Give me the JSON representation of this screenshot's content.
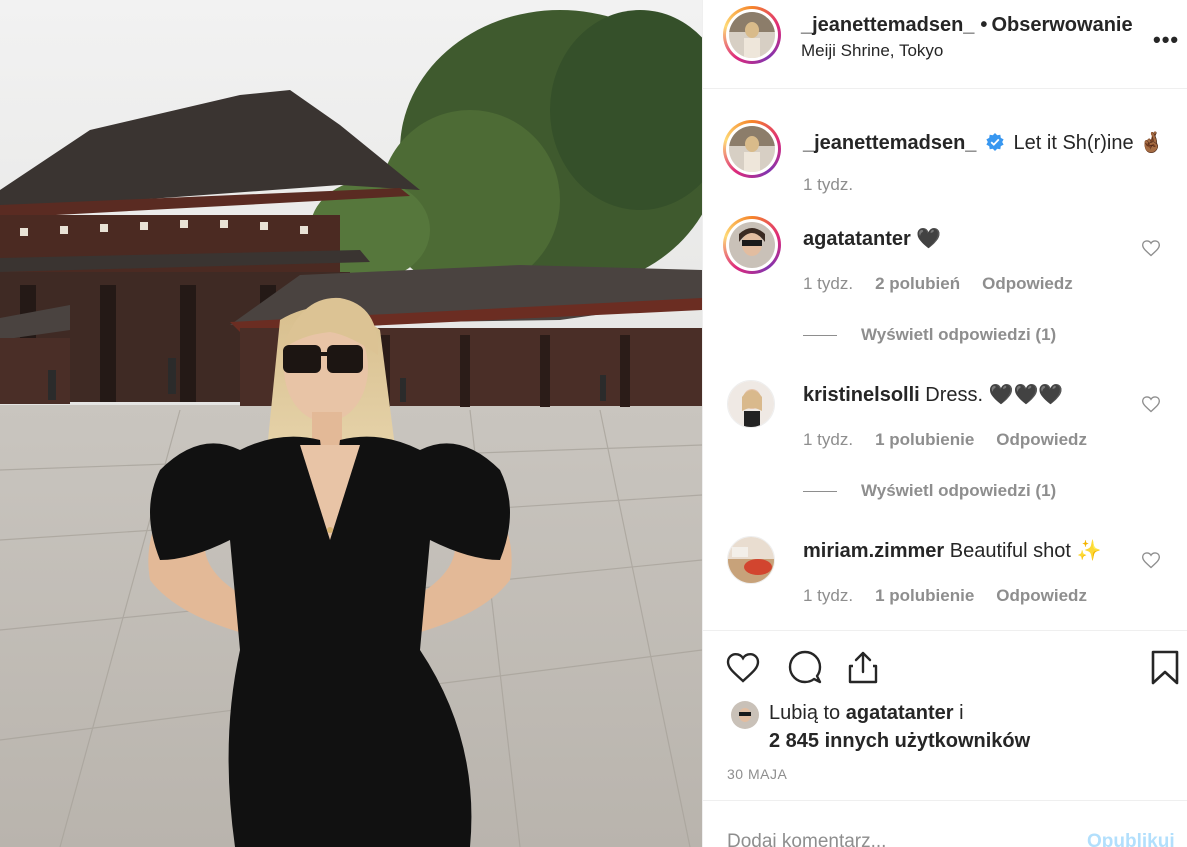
{
  "header": {
    "username": "_jeanettemadsen_",
    "separator": "•",
    "follow_label": "Obserwowanie",
    "location": "Meiji Shrine, Tokyo",
    "more_label": "•••"
  },
  "caption": {
    "username": "_jeanettemadsen_",
    "verified_icon": "verified-badge-icon",
    "text": "Let it Sh(r)ine 🤞🏾",
    "time": "1 tydz."
  },
  "comments": [
    {
      "username": "agatatanter",
      "text": "🖤",
      "time": "1 tydz.",
      "likes": "2 polubień",
      "reply_label": "Odpowiedz",
      "view_replies": "Wyświetl odpowiedzi (1)"
    },
    {
      "username": "kristinelsolli",
      "text": "Dress. 🖤🖤🖤",
      "time": "1 tydz.",
      "likes": "1 polubienie",
      "reply_label": "Odpowiedz",
      "view_replies": "Wyświetl odpowiedzi (1)"
    },
    {
      "username": "miriam.zimmer",
      "text": "Beautiful shot ✨",
      "time": "1 tydz.",
      "likes": "1 polubienie",
      "reply_label": "Odpowiedz"
    }
  ],
  "likes": {
    "prefix": "Lubią to",
    "user": "agatatanter",
    "conj": "i",
    "count_text": "2 845 innych użytkowników"
  },
  "date": "30 MAJA",
  "add_comment": {
    "placeholder": "Dodaj komentarz...",
    "publish_label": "Opublikuj"
  },
  "colors": {
    "text": "#262626",
    "secondary": "#8e8e8e",
    "verified": "#3897f0",
    "publish_disabled": "#b2dffc",
    "border": "#efefef"
  }
}
